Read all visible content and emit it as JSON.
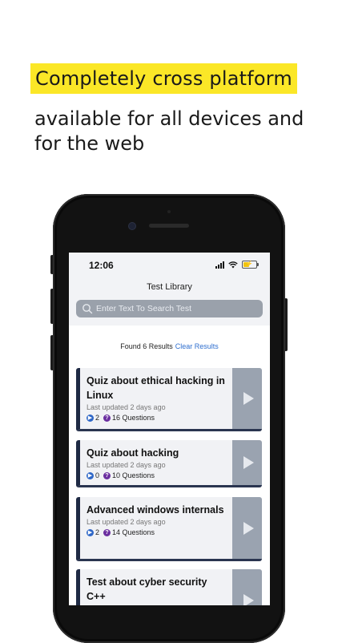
{
  "promo": {
    "headline": "Completely cross platform",
    "subline": "available for all devices and for the web"
  },
  "status_bar": {
    "time": "12:06"
  },
  "screen": {
    "title": "Test Library",
    "search_placeholder": "Enter Text To Search Test",
    "results_text": "Found 6 Results",
    "clear_label": "Clear Results"
  },
  "cards": [
    {
      "title": "Quiz about ethical hacking in Linux",
      "updated": "Last updated 2 days ago",
      "plays": "2",
      "questions": "16 Questions"
    },
    {
      "title": "Quiz about hacking",
      "updated": "Last updated 2 days ago",
      "plays": "0",
      "questions": "10 Questions"
    },
    {
      "title": "Advanced windows internals",
      "updated": "Last updated 2 days ago",
      "plays": "2",
      "questions": "14 Questions"
    },
    {
      "title": "Test about cyber security C++",
      "updated": "",
      "plays": "",
      "questions": ""
    }
  ],
  "colors": {
    "highlight": "#fbe727",
    "card_accent": "#1f2a44",
    "play_panel": "#9aa3b0",
    "link": "#2f6fcf"
  }
}
